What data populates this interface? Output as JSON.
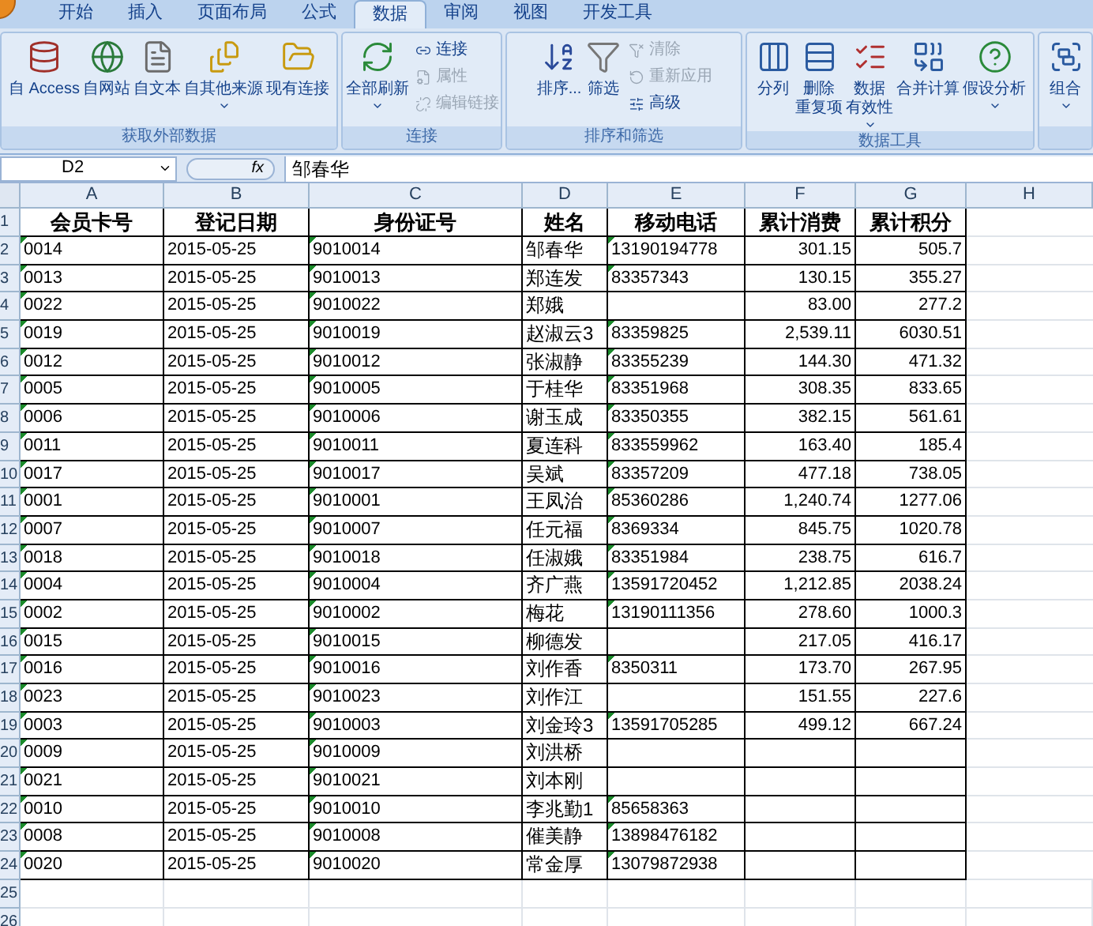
{
  "tabs": [
    {
      "label": "开始",
      "selected": false
    },
    {
      "label": "插入",
      "selected": false
    },
    {
      "label": "页面布局",
      "selected": false
    },
    {
      "label": "公式",
      "selected": false
    },
    {
      "label": "数据",
      "selected": true
    },
    {
      "label": "审阅",
      "selected": false
    },
    {
      "label": "视图",
      "selected": false
    },
    {
      "label": "开发工具",
      "selected": false
    }
  ],
  "ribbon_groups": [
    {
      "title": "获取外部数据",
      "large": [
        {
          "label": [
            "自 Access"
          ],
          "dropdown": false
        },
        {
          "label": [
            "自网站"
          ],
          "dropdown": false
        },
        {
          "label": [
            "自文本"
          ],
          "dropdown": false
        },
        {
          "label": [
            "自其他来源"
          ],
          "dropdown": true
        },
        {
          "label": [
            "现有连接"
          ],
          "dropdown": false
        }
      ]
    },
    {
      "title": "连接",
      "large": [
        {
          "label": [
            "全部刷新"
          ],
          "dropdown": true
        }
      ],
      "small": [
        {
          "label": "连接",
          "disabled": false
        },
        {
          "label": "属性",
          "disabled": true
        },
        {
          "label": "编辑链接",
          "disabled": true
        }
      ]
    },
    {
      "title": "排序和筛选",
      "large": [
        {
          "label": [
            "排序..."
          ],
          "dropdown": false
        },
        {
          "label": [
            "筛选"
          ],
          "dropdown": false
        }
      ],
      "small": [
        {
          "label": "清除",
          "disabled": true
        },
        {
          "label": "重新应用",
          "disabled": true
        },
        {
          "label": "高级",
          "disabled": false
        }
      ]
    },
    {
      "title": "数据工具",
      "large": [
        {
          "label": [
            "分列"
          ],
          "dropdown": false
        },
        {
          "label": [
            "删除",
            "重复项"
          ],
          "dropdown": false
        },
        {
          "label": [
            "数据",
            "有效性"
          ],
          "dropdown": true
        },
        {
          "label": [
            "合并计算"
          ],
          "dropdown": false
        },
        {
          "label": [
            "假设分析"
          ],
          "dropdown": true
        }
      ]
    },
    {
      "large": [
        {
          "label": [
            "组合"
          ],
          "dropdown": true
        }
      ]
    }
  ],
  "formula_bar": {
    "name_box": "D2",
    "fx": "fx",
    "value": "邹春华"
  },
  "columns": [
    "A",
    "B",
    "C",
    "D",
    "E",
    "F",
    "G",
    "H"
  ],
  "header_row": {
    "n": "1",
    "cells": [
      "会员卡号",
      "登记日期",
      "身份证号",
      "姓名",
      "移动电话",
      "累计消费",
      "累计积分"
    ]
  },
  "rows": [
    {
      "n": "2",
      "cells": [
        "0014",
        "2015-05-25",
        "9010014",
        "邹春华",
        "13190194778",
        "301.15",
        "505.7"
      ]
    },
    {
      "n": "3",
      "cells": [
        "0013",
        "2015-05-25",
        "9010013",
        "郑连发",
        "83357343",
        "130.15",
        "355.27"
      ]
    },
    {
      "n": "4",
      "cells": [
        "0022",
        "2015-05-25",
        "9010022",
        "郑娥",
        "",
        "83.00",
        "277.2"
      ]
    },
    {
      "n": "5",
      "cells": [
        "0019",
        "2015-05-25",
        "9010019",
        "赵淑云3",
        "83359825",
        "2,539.11",
        "6030.51"
      ]
    },
    {
      "n": "6",
      "cells": [
        "0012",
        "2015-05-25",
        "9010012",
        "张淑静",
        "83355239",
        "144.30",
        "471.32"
      ]
    },
    {
      "n": "7",
      "cells": [
        "0005",
        "2015-05-25",
        "9010005",
        "于桂华",
        "83351968",
        "308.35",
        "833.65"
      ]
    },
    {
      "n": "8",
      "cells": [
        "0006",
        "2015-05-25",
        "9010006",
        "谢玉成",
        "83350355",
        "382.15",
        "561.61"
      ]
    },
    {
      "n": "9",
      "cells": [
        "0011",
        "2015-05-25",
        "9010011",
        "夏连科",
        "833559962",
        "163.40",
        "185.4"
      ]
    },
    {
      "n": "10",
      "cells": [
        "0017",
        "2015-05-25",
        "9010017",
        "吴斌",
        "83357209",
        "477.18",
        "738.05"
      ]
    },
    {
      "n": "11",
      "cells": [
        "0001",
        "2015-05-25",
        "9010001",
        "王凤治",
        "85360286",
        "1,240.74",
        "1277.06"
      ]
    },
    {
      "n": "12",
      "cells": [
        "0007",
        "2015-05-25",
        "9010007",
        "任元福",
        "8369334",
        "845.75",
        "1020.78"
      ]
    },
    {
      "n": "13",
      "cells": [
        "0018",
        "2015-05-25",
        "9010018",
        "任淑娥",
        "83351984",
        "238.75",
        "616.7"
      ]
    },
    {
      "n": "14",
      "cells": [
        "0004",
        "2015-05-25",
        "9010004",
        "齐广燕",
        "13591720452",
        "1,212.85",
        "2038.24"
      ]
    },
    {
      "n": "15",
      "cells": [
        "0002",
        "2015-05-25",
        "9010002",
        "梅花",
        "13190111356",
        "278.60",
        "1000.3"
      ]
    },
    {
      "n": "16",
      "cells": [
        "0015",
        "2015-05-25",
        "9010015",
        "柳德发",
        "",
        "217.05",
        "416.17"
      ]
    },
    {
      "n": "17",
      "cells": [
        "0016",
        "2015-05-25",
        "9010016",
        "刘作香",
        "8350311",
        "173.70",
        "267.95"
      ]
    },
    {
      "n": "18",
      "cells": [
        "0023",
        "2015-05-25",
        "9010023",
        "刘作江",
        "",
        "151.55",
        "227.6"
      ]
    },
    {
      "n": "19",
      "cells": [
        "0003",
        "2015-05-25",
        "9010003",
        "刘金玲3",
        "13591705285",
        "499.12",
        "667.24"
      ]
    },
    {
      "n": "20",
      "cells": [
        "0009",
        "2015-05-25",
        "9010009",
        "刘洪桥",
        "",
        "",
        ""
      ]
    },
    {
      "n": "21",
      "cells": [
        "0021",
        "2015-05-25",
        "9010021",
        "刘本刚",
        "",
        "",
        ""
      ]
    },
    {
      "n": "22",
      "cells": [
        "0010",
        "2015-05-25",
        "9010010",
        "李兆勤1",
        "85658363",
        "",
        ""
      ]
    },
    {
      "n": "23",
      "cells": [
        "0008",
        "2015-05-25",
        "9010008",
        "催美静",
        "13898476182",
        "",
        ""
      ]
    },
    {
      "n": "24",
      "cells": [
        "0020",
        "2015-05-25",
        "9010020",
        "常金厚",
        "13079872938",
        "",
        ""
      ]
    }
  ],
  "empty_rows": [
    "25",
    "26"
  ]
}
